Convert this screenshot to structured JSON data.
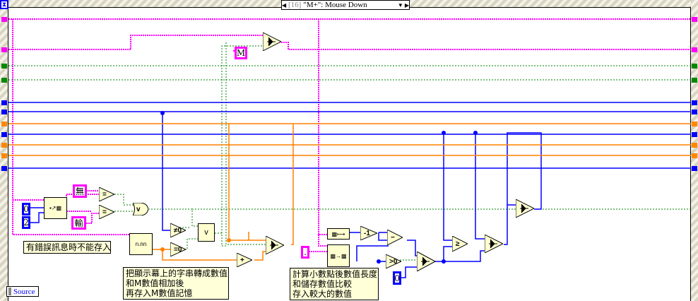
{
  "case_selector": {
    "index": "[16]",
    "label": "\"M+\": Mouse Down"
  },
  "constants": {
    "m": "M",
    "wu": "無",
    "shu": "輸",
    "zero": "0",
    "two": "2",
    "dot": ".",
    "zero2": "0"
  },
  "operators": {
    "eq1": "=",
    "eq2": "=",
    "or": "v",
    "neq0": "≠0",
    "eq0": "=0",
    "or2": "v",
    "add": "+",
    "minus1": "-1",
    "sub": "−",
    "gt0": ">0",
    "ge": "≥"
  },
  "comments": {
    "error": "有錯誤訊息時不能存入",
    "convert": "把顯示幕上的字串轉成數值\n和M數值相加後\n再存入M數值記憶",
    "decimal": "計算小數點後數值長度\n和儲存數值比較\n存入較大的數值"
  },
  "source_label": "Source",
  "wire_colors": {
    "string": "#ff00ff",
    "integer": "#0000ff",
    "double": "#ff8000",
    "boolean": "#008000"
  }
}
